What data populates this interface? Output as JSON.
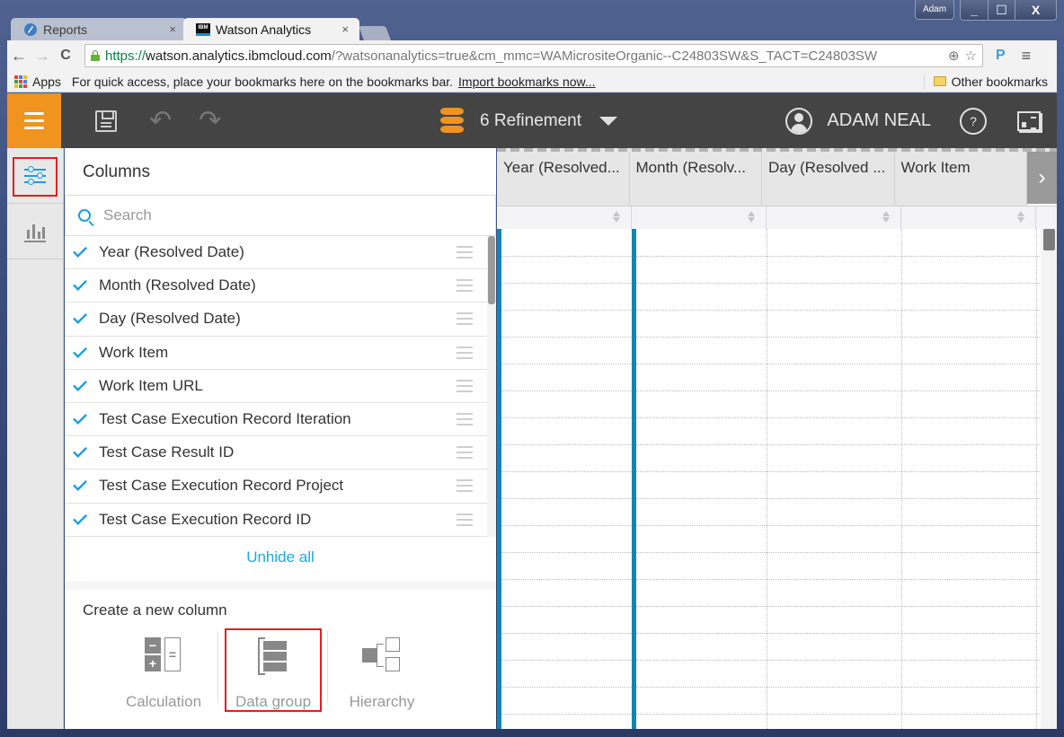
{
  "window": {
    "user_badge": "Adam",
    "controls": {
      "minimize": "_",
      "maximize": "☐",
      "close": "X"
    }
  },
  "tabs": [
    {
      "title": "Reports",
      "icon": "reports-app-icon",
      "active": false,
      "close": "×"
    },
    {
      "title": "Watson Analytics",
      "icon": "ibm-logo-icon",
      "active": true,
      "close": "×"
    }
  ],
  "toolbar": {
    "back": "←",
    "forward": "→",
    "reload": "C",
    "url_scheme": "https://",
    "url_host": "watson.analytics.ibmcloud.com",
    "url_rest": "/?watsonanalytics=true&cm_mmc=WAMicrositeOrganic--C24803SW&S_TACT=C24803SW",
    "zoom_icon": "⊕",
    "star_icon": "☆",
    "extension_label": "P",
    "menu_icon": "≡"
  },
  "bookmarks": {
    "apps_label": "Apps",
    "hint": "For quick access, place your bookmarks here on the bookmarks bar.",
    "import_link": "Import bookmarks now...",
    "other": "Other bookmarks"
  },
  "app_header": {
    "undo_icon": "↶",
    "redo_icon": "↷",
    "dataset_name": "6 Refinement",
    "user_name": "ADAM NEAL",
    "help_label": "?",
    "brand_color": "#f0931f",
    "bar_color": "#444444"
  },
  "columns_panel": {
    "title": "Columns",
    "search_placeholder": "Search",
    "items": [
      {
        "label": "Year (Resolved Date)",
        "checked": true
      },
      {
        "label": "Month (Resolved Date)",
        "checked": true
      },
      {
        "label": "Day (Resolved Date)",
        "checked": true
      },
      {
        "label": "Work Item",
        "checked": true
      },
      {
        "label": "Work Item URL",
        "checked": true
      },
      {
        "label": "Test Case Execution Record Iteration",
        "checked": true
      },
      {
        "label": "Test Case Result ID",
        "checked": true
      },
      {
        "label": "Test Case Execution Record Project",
        "checked": true
      },
      {
        "label": "Test Case Execution Record ID",
        "checked": true
      }
    ],
    "unhide_all": "Unhide all",
    "create_title": "Create a new column",
    "create_options": [
      {
        "label": "Calculation"
      },
      {
        "label": "Data group",
        "highlighted": true
      },
      {
        "label": "Hierarchy"
      }
    ],
    "accent_color": "#1a9fdf"
  },
  "grid": {
    "headers": [
      "Year (Resolved...",
      "Month (Resolv...",
      "Day (Resolved ...",
      "Work Item"
    ],
    "next_icon": "›",
    "accent_color": "#1485b0"
  }
}
